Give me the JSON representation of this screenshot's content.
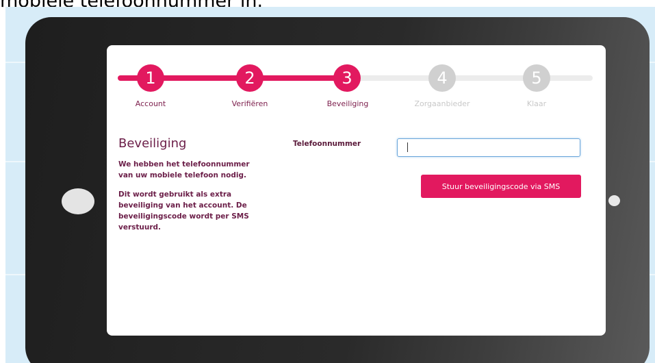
{
  "caption": "mobiele telefoonnummer in.",
  "colors": {
    "accent": "#e2195f",
    "text_dark": "#6b1e48",
    "inactive": "#d0d0d0",
    "background": "#d7ecf8"
  },
  "stepper": {
    "current_step": 3,
    "steps": [
      {
        "number": "1",
        "label": "Account",
        "state": "done"
      },
      {
        "number": "2",
        "label": "Verifiëren",
        "state": "done"
      },
      {
        "number": "3",
        "label": "Beveiliging",
        "state": "current"
      },
      {
        "number": "4",
        "label": "Zorgaanbieder",
        "state": "todo"
      },
      {
        "number": "5",
        "label": "Klaar",
        "state": "todo"
      }
    ]
  },
  "section": {
    "title": "Beveiliging",
    "paragraph_1": "We hebben het telefoonnummer van uw mobiele telefoon nodig.",
    "paragraph_2": "Dit wordt gebruikt als extra beveiliging van het account. De beveiligingscode wordt per SMS verstuurd."
  },
  "form": {
    "phone_label": "Telefoonnummer",
    "phone_value": "",
    "sms_button_label": "Stuur beveiligingscode via SMS"
  }
}
